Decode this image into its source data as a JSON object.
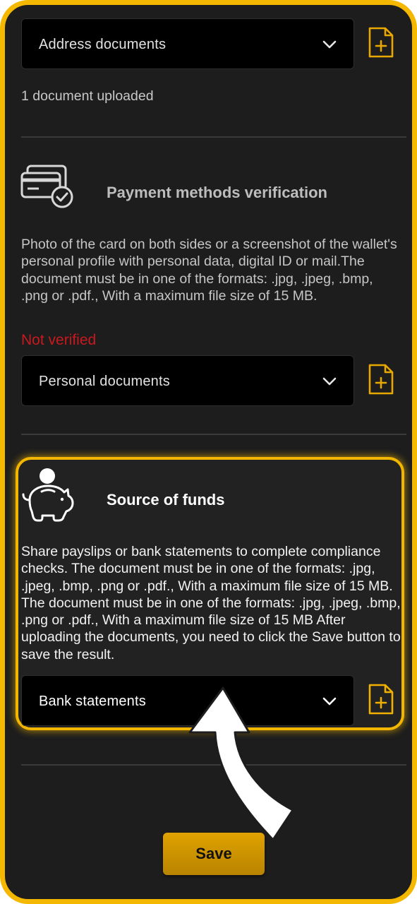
{
  "address": {
    "select_value": "Address documents",
    "status_text": "1 document uploaded"
  },
  "payment": {
    "title": "Payment methods verification",
    "description": "Photo of the card on both sides or a screenshot of the wallet's personal profile with personal data, digital ID or mail.The document must be in one of the formats: .jpg, .jpeg, .bmp, .png or .pdf., With a maximum file size of 15 MB.",
    "status": "Not verified",
    "select_value": "Personal documents"
  },
  "funds": {
    "title": "Source of funds",
    "description": "Share payslips or bank statements to complete compliance checks. The document must be in one of the formats: .jpg, .jpeg, .bmp, .png or .pdf., With a maximum file size of 15 MB. The document must be in one of the formats: .jpg, .jpeg, .bmp, .png or .pdf., With a maximum file size of 15 MB After uploading the documents, you need to click the Save button to save the result.",
    "select_value": "Bank statements"
  },
  "save_label": "Save",
  "colors": {
    "accent": "#f5b800",
    "background": "#1d1d1d",
    "not_verified": "#c8191f",
    "save_button": "#d19600"
  },
  "icons": {
    "upload": "file-add-icon",
    "dropdown": "chevron-down-icon",
    "payment": "credit-card-check-icon",
    "funds": "piggy-bank-icon",
    "annotation": "curved-arrow-icon"
  }
}
